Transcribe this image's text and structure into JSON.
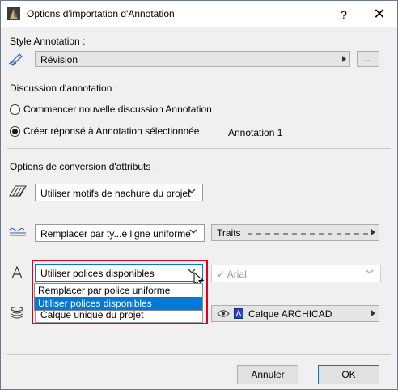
{
  "window": {
    "title": "Options d'importation d'Annotation",
    "help_label": "?",
    "close_label": "✕"
  },
  "style_section": {
    "label": "Style Annotation :",
    "value": "Révision",
    "browse_label": "..."
  },
  "discussion_section": {
    "label": "Discussion d'annotation :",
    "option_new": "Commencer nouvelle discussion Annotation",
    "option_reply": "Créer réponsé à Annotation sélectionnée",
    "reply_target": "Annotation 1",
    "selected": "option_reply"
  },
  "conversion_section": {
    "label": "Options de conversion d'attributs :",
    "hatch_value": "Utiliser motifs de hachure du projet",
    "line_value": "Remplacer par ty...e ligne uniforme",
    "line_type_value": "Traits",
    "font_value": "Utiliser polices disponibles",
    "font_replacement": "Arial",
    "layer_value": "Calque unique du projet",
    "layer_target": "Calque ARCHICAD"
  },
  "font_dropdown": {
    "options": [
      "Remplacer par police uniforme",
      "Utiliser polices disponibles"
    ],
    "selected_index": 1
  },
  "footer": {
    "cancel_label": "Annuler",
    "ok_label": "OK"
  },
  "colors": {
    "highlight_border": "#e0001b",
    "selection_blue": "#0078d7"
  },
  "icons": {
    "app": "archicad-app-icon",
    "style": "pen-icon",
    "hatch": "hatch-icon",
    "line": "line-type-icon",
    "font": "font-icon",
    "layer": "layers-icon",
    "eye": "eye-icon",
    "layer_color": "layer-color-icon"
  }
}
